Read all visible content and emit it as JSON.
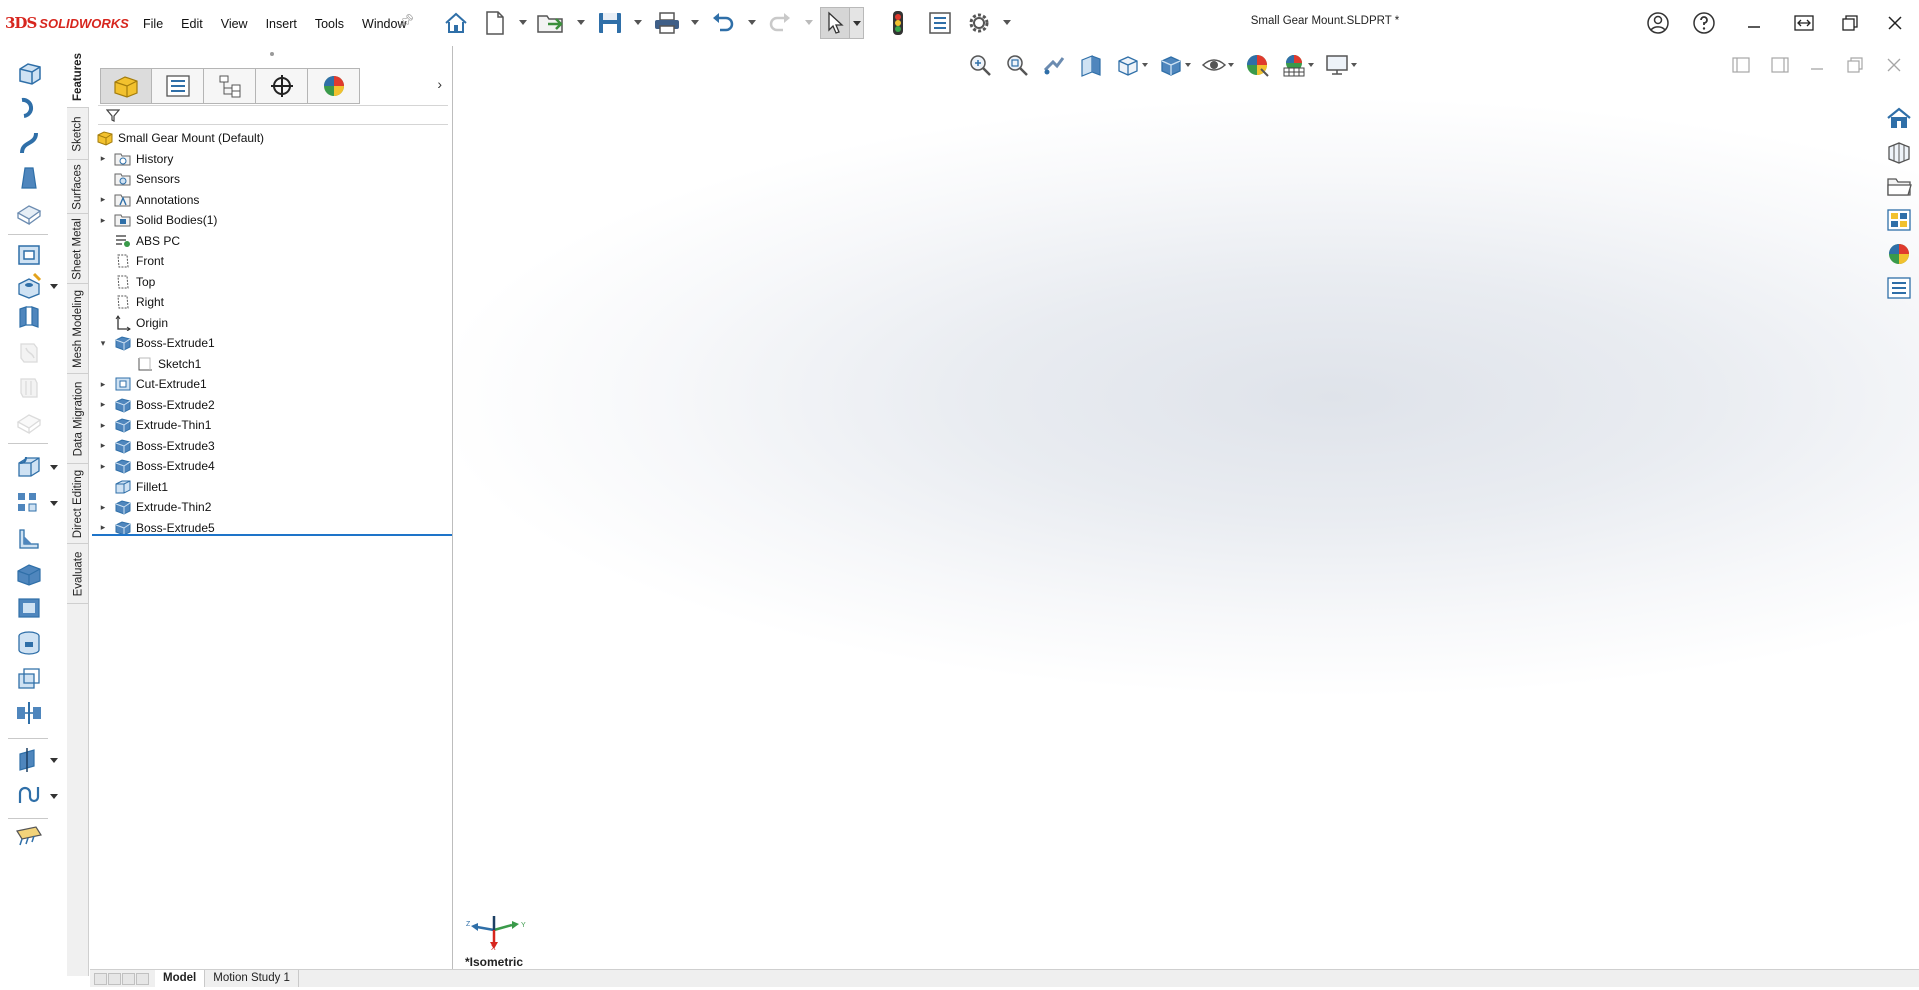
{
  "app": {
    "brand_mark": "3DS",
    "brand_name": "SOLIDWORKS"
  },
  "menu": [
    "File",
    "Edit",
    "View",
    "Insert",
    "Tools",
    "Window"
  ],
  "document_title": "Small Gear Mount.SLDPRT *",
  "vertical_tabs": [
    "Features",
    "Sketch",
    "Surfaces",
    "Sheet Metal",
    "Mesh Modeling",
    "Data Migration",
    "Direct Editing",
    "Evaluate"
  ],
  "feature_tree": [
    {
      "label": "Small Gear Mount (Default)",
      "icon": "part-icon",
      "level": 0,
      "expand": "none"
    },
    {
      "label": "History",
      "icon": "history-icon",
      "level": 1,
      "expand": "collapsed"
    },
    {
      "label": "Sensors",
      "icon": "sensor-icon",
      "level": 1,
      "expand": "none"
    },
    {
      "label": "Annotations",
      "icon": "annotation-icon",
      "level": 1,
      "expand": "collapsed"
    },
    {
      "label": "Solid Bodies(1)",
      "icon": "solid-bodies-icon",
      "level": 1,
      "expand": "collapsed"
    },
    {
      "label": "ABS PC",
      "icon": "material-icon",
      "level": 1,
      "expand": "none"
    },
    {
      "label": "Front",
      "icon": "plane-icon",
      "level": 1,
      "expand": "none"
    },
    {
      "label": "Top",
      "icon": "plane-icon",
      "level": 1,
      "expand": "none"
    },
    {
      "label": "Right",
      "icon": "plane-icon",
      "level": 1,
      "expand": "none"
    },
    {
      "label": "Origin",
      "icon": "origin-icon",
      "level": 1,
      "expand": "none"
    },
    {
      "label": "Boss-Extrude1",
      "icon": "extrude-icon",
      "level": 1,
      "expand": "expanded"
    },
    {
      "label": "Sketch1",
      "icon": "sketch-icon",
      "level": 2,
      "expand": "none"
    },
    {
      "label": "Cut-Extrude1",
      "icon": "cut-extrude-icon",
      "level": 1,
      "expand": "collapsed"
    },
    {
      "label": "Boss-Extrude2",
      "icon": "extrude-icon",
      "level": 1,
      "expand": "collapsed"
    },
    {
      "label": "Extrude-Thin1",
      "icon": "extrude-icon",
      "level": 1,
      "expand": "collapsed"
    },
    {
      "label": "Boss-Extrude3",
      "icon": "extrude-icon",
      "level": 1,
      "expand": "collapsed"
    },
    {
      "label": "Boss-Extrude4",
      "icon": "extrude-icon",
      "level": 1,
      "expand": "collapsed"
    },
    {
      "label": "Fillet1",
      "icon": "fillet-icon",
      "level": 1,
      "expand": "none"
    },
    {
      "label": "Extrude-Thin2",
      "icon": "extrude-icon",
      "level": 1,
      "expand": "collapsed"
    },
    {
      "label": "Boss-Extrude5",
      "icon": "extrude-icon",
      "level": 1,
      "expand": "collapsed"
    }
  ],
  "viewport": {
    "view_label": "*Isometric",
    "triad_axes": [
      "Z",
      "Y",
      "X"
    ]
  },
  "bottom_tabs": [
    "Model",
    "Motion Study 1"
  ],
  "colors": {
    "brand": "#d7261e",
    "accent_blue": "#1e74c9",
    "icon_blue": "#2f7fc1"
  }
}
